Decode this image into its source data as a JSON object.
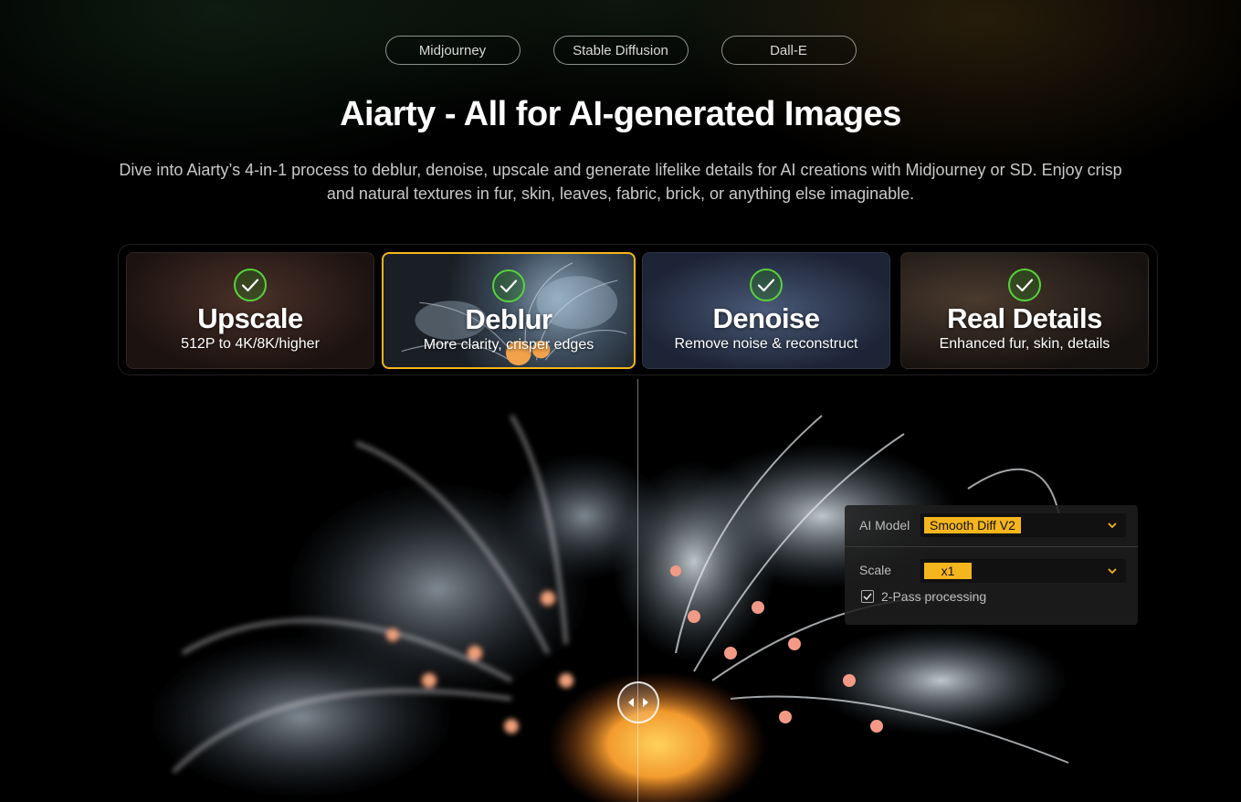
{
  "models": {
    "items": [
      "Midjourney",
      "Stable Diffusion",
      "Dall-E"
    ]
  },
  "hero": {
    "title": "Aiarty - All for AI-generated Images",
    "subtitle": "Dive into Aiarty’s 4-in-1 process to deblur, denoise, upscale and generate lifelike details for AI creations with Midjourney or SD. Enjoy crisp and natural textures in fur, skin, leaves, fabric, brick, or anything else imaginable."
  },
  "features": [
    {
      "title": "Upscale",
      "subtitle": "512P to 4K/8K/higher",
      "icon": "check-circle-icon"
    },
    {
      "title": "Deblur",
      "subtitle": "More clarity, crisper edges",
      "icon": "check-circle-icon",
      "selected": true
    },
    {
      "title": "Denoise",
      "subtitle": "Remove noise & reconstruct",
      "icon": "check-circle-icon"
    },
    {
      "title": "Real Details",
      "subtitle": "Enhanced fur, skin, details",
      "icon": "check-circle-icon"
    }
  ],
  "settings": {
    "ai_model_label": "AI Model",
    "ai_model_value": "Smooth Diff V2",
    "scale_label": "Scale",
    "scale_value": "x1",
    "two_pass_label": "2-Pass processing",
    "two_pass_checked": true
  },
  "colors": {
    "accent": "#f5b51c",
    "check_green": "#58d23c"
  }
}
